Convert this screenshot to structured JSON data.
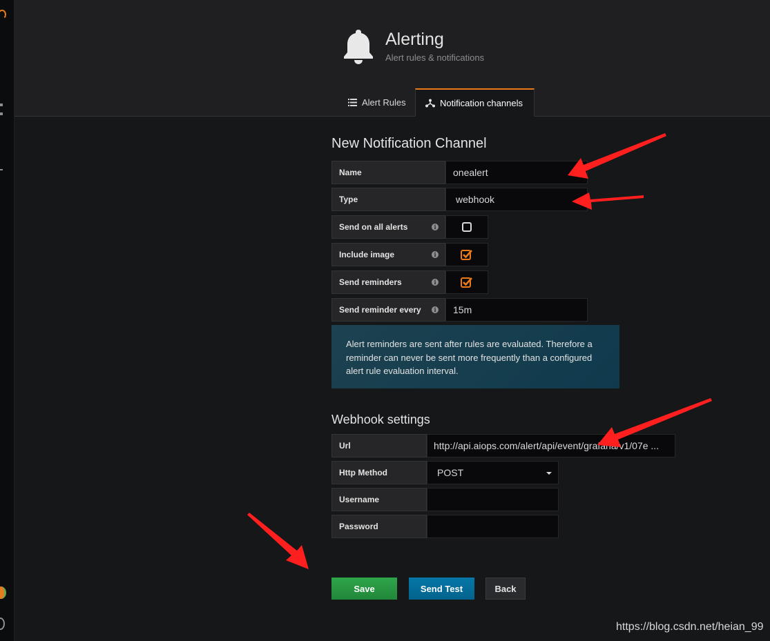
{
  "header": {
    "title": "Alerting",
    "subtitle": "Alert rules & notifications"
  },
  "tabs": [
    {
      "label": "Alert Rules",
      "icon": "list-icon",
      "active": false
    },
    {
      "label": "Notification channels",
      "icon": "channels-icon",
      "active": true
    }
  ],
  "form": {
    "title": "New Notification Channel",
    "name_label": "Name",
    "name_value": "onealert",
    "type_label": "Type",
    "type_value": "webhook",
    "send_all_label": "Send on all alerts",
    "send_all_checked": false,
    "include_image_label": "Include image",
    "include_image_checked": true,
    "send_reminders_label": "Send reminders",
    "send_reminders_checked": true,
    "reminder_every_label": "Send reminder every",
    "reminder_every_value": "15m",
    "info_text": "Alert reminders are sent after rules are evaluated. Therefore a reminder can never be sent more frequently than a configured alert rule evaluation interval."
  },
  "webhook": {
    "title": "Webhook settings",
    "url_label": "Url",
    "url_value": "http://api.aiops.com/alert/api/event/grafana/v1/07e ...",
    "method_label": "Http Method",
    "method_value": "POST",
    "username_label": "Username",
    "username_value": "",
    "password_label": "Password",
    "password_value": ""
  },
  "buttons": {
    "save": "Save",
    "send_test": "Send Test",
    "back": "Back"
  },
  "colors": {
    "accent": "#eb7b18",
    "save": "#299c46",
    "send_test": "#05719f",
    "annotation": "#ff1f1f"
  },
  "watermark": "https://blog.csdn.net/heian_99"
}
